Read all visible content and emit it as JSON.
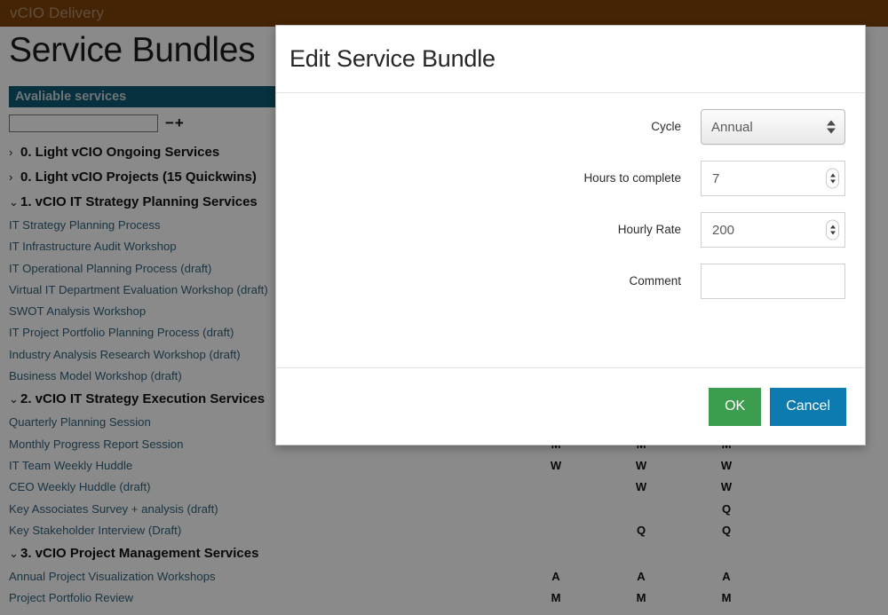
{
  "topbar": {
    "brand": "vCIO Delivery"
  },
  "page": {
    "title": "Service Bundles",
    "available_header": "Avaliable services",
    "search_value": "",
    "search_placeholder": "",
    "minus_plus": "−+"
  },
  "columns": {
    "count": 3
  },
  "tree": [
    {
      "type": "group",
      "label": "0. Light vCIO Ongoing Services",
      "caret": "›",
      "cells": [
        "",
        "",
        ""
      ]
    },
    {
      "type": "group",
      "label": "0. Light vCIO Projects (15 Quickwins)",
      "caret": "›",
      "cells": [
        "",
        "",
        ""
      ]
    },
    {
      "type": "group",
      "label": "1. vCIO IT Strategy Planning Services",
      "caret": "⌄",
      "cells": [
        "",
        "",
        ""
      ]
    },
    {
      "type": "service",
      "label": "IT Strategy Planning Process",
      "cells": [
        "",
        "",
        ""
      ]
    },
    {
      "type": "service",
      "label": "IT Infrastructure Audit Workshop",
      "cells": [
        "",
        "",
        ""
      ]
    },
    {
      "type": "service",
      "label": "IT Operational Planning Process (draft)",
      "cells": [
        "",
        "",
        ""
      ]
    },
    {
      "type": "service",
      "label": "Virtual IT Department Evaluation Workshop (draft)",
      "cells": [
        "",
        "",
        ""
      ]
    },
    {
      "type": "service",
      "label": "SWOT Analysis Workshop",
      "cells": [
        "",
        "",
        ""
      ]
    },
    {
      "type": "service",
      "label": "IT Project Portfolio Planning Process (draft)",
      "cells": [
        "",
        "",
        ""
      ]
    },
    {
      "type": "service",
      "label": "Industry Analysis Research Workshop (draft)",
      "cells": [
        "",
        "",
        ""
      ]
    },
    {
      "type": "service",
      "label": "Business Model Workshop (draft)",
      "cells": [
        "",
        "",
        ""
      ]
    },
    {
      "type": "group",
      "label": "2. vCIO IT Strategy Execution Services",
      "caret": "⌄",
      "cells": [
        "",
        "",
        ""
      ]
    },
    {
      "type": "service",
      "label": "Quarterly Planning Session",
      "cells": [
        "",
        "",
        ""
      ]
    },
    {
      "type": "service",
      "label": "Monthly Progress Report Session",
      "cells": [
        "M",
        "M",
        "M"
      ]
    },
    {
      "type": "service",
      "label": "IT Team Weekly Huddle",
      "cells": [
        "W",
        "W",
        "W"
      ]
    },
    {
      "type": "service",
      "label": "CEO Weekly Huddle (draft)",
      "cells": [
        "",
        "W",
        "W"
      ]
    },
    {
      "type": "service",
      "label": "Key Associates Survey + analysis (draft)",
      "cells": [
        "",
        "",
        "Q"
      ]
    },
    {
      "type": "service",
      "label": "Key Stakeholder Interview (Draft)",
      "cells": [
        "",
        "Q",
        "Q"
      ]
    },
    {
      "type": "group",
      "label": "3. vCIO Project Management Services",
      "caret": "⌄",
      "cells": [
        "",
        "",
        ""
      ]
    },
    {
      "type": "service",
      "label": "Annual Project Visualization Workshops",
      "cells": [
        "A",
        "A",
        "A"
      ]
    },
    {
      "type": "service",
      "label": "Project Portfolio Review",
      "cells": [
        "M",
        "M",
        "M"
      ]
    }
  ],
  "modal": {
    "title": "Edit Service Bundle",
    "fields": {
      "cycle_label": "Cycle",
      "cycle_value": "Annual",
      "cycle_options": [
        "Annual"
      ],
      "hours_label": "Hours to complete",
      "hours_value": "7",
      "rate_label": "Hourly Rate",
      "rate_value": "200",
      "comment_label": "Comment",
      "comment_value": "",
      "comment_placeholder": ""
    },
    "ok_label": "OK",
    "cancel_label": "Cancel"
  },
  "colors": {
    "topbar": "#7e4409",
    "section_header": "#0d5c74",
    "link": "#31627c",
    "ok": "#3c9d4e",
    "cancel": "#0d7ab0"
  }
}
